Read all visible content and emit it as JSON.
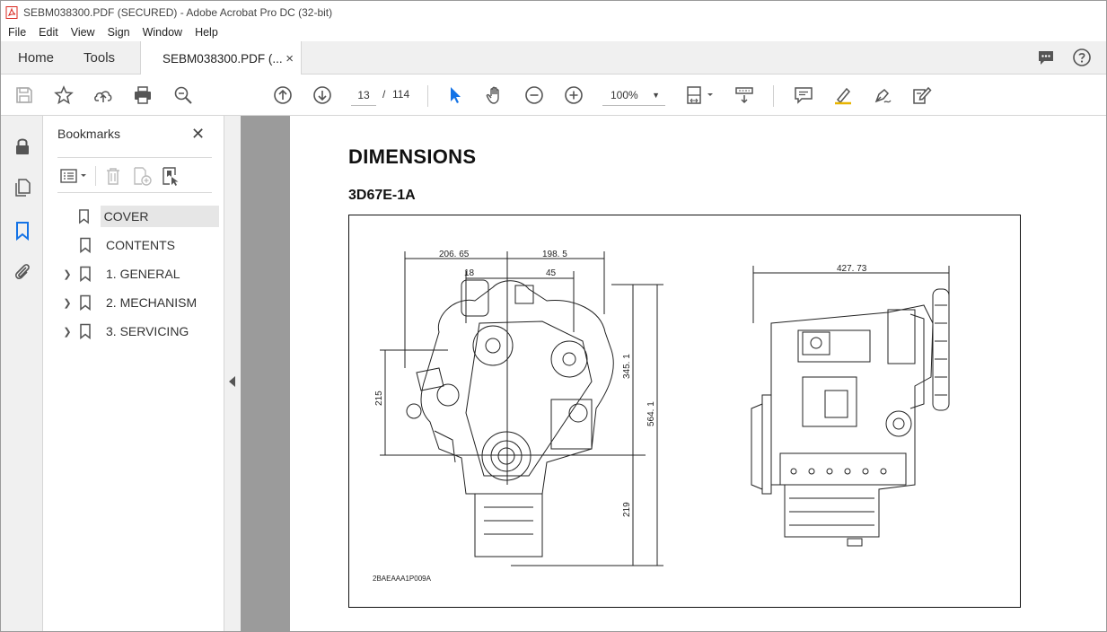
{
  "window": {
    "title": "SEBM038300.PDF (SECURED) - Adobe Acrobat Pro DC (32-bit)"
  },
  "menu": [
    "File",
    "Edit",
    "View",
    "Sign",
    "Window",
    "Help"
  ],
  "tabs": {
    "home": "Home",
    "tools": "Tools",
    "document": "SEBM038300.PDF (...",
    "close": "×"
  },
  "toolbar": {
    "page_current": "13",
    "page_separator": "/",
    "page_total": "114",
    "zoom": "100%"
  },
  "bookmarks": {
    "title": "Bookmarks",
    "close": "✕",
    "items": [
      {
        "label": "COVER",
        "expandable": false,
        "selected": true
      },
      {
        "label": "CONTENTS",
        "expandable": false,
        "selected": false
      },
      {
        "label": "1. GENERAL",
        "expandable": true,
        "selected": false
      },
      {
        "label": "2. MECHANISM",
        "expandable": true,
        "selected": false
      },
      {
        "label": "3. SERVICING",
        "expandable": true,
        "selected": false
      }
    ]
  },
  "document": {
    "heading": "DIMENSIONS",
    "subheading": "3D67E-1A",
    "figure_code": "2BAEAAA1P009A",
    "dimensions": {
      "d1": "206. 65",
      "d2": "198. 5",
      "d3": "18",
      "d4": "45",
      "d5": "215",
      "d6": "345. 1",
      "d7": "564. 1",
      "d8": "219",
      "d9": "427. 73"
    }
  },
  "colors": {
    "accent_blue": "#1473e6",
    "pdf_red": "#d9271e",
    "docview_gray": "#9b9b9b"
  }
}
